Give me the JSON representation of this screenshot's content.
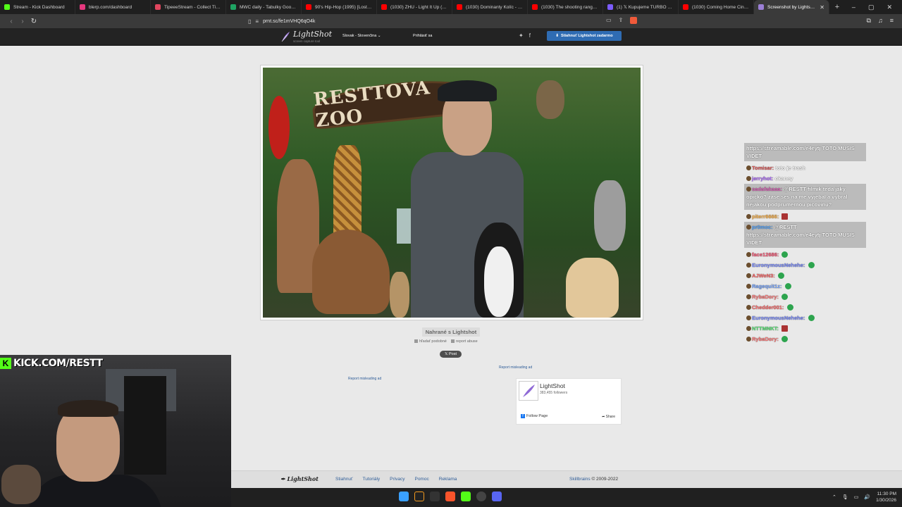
{
  "browser": {
    "tabs": [
      {
        "title": "Stream - Kick Dashboard",
        "color": "#53fc18"
      },
      {
        "title": "blerp.com/dashboard",
        "color": "#e5387e"
      },
      {
        "title": "TipeeeStream - Collect Tips wi",
        "color": "#e0465e"
      },
      {
        "title": "MWC daily - Tabulky Google",
        "color": "#1fa463"
      },
      {
        "title": "90's Hip-Hop (1995) [Lost Der",
        "color": "#ff0000"
      },
      {
        "title": "(1030) ZHU - Light It Up (feat.",
        "color": "#ff0000"
      },
      {
        "title": "(1030) Dominanty Kolíc - ZOO",
        "color": "#ff0000"
      },
      {
        "title": "(1030) The shooting range whe",
        "color": "#ff0000"
      },
      {
        "title": "(1) 𝕏 Kupujeme TURBO na po",
        "color": "#7c5cff"
      },
      {
        "title": "(1030) Coming Home Cinemati",
        "color": "#ff0000"
      },
      {
        "title": "Screenshot by Lightshot",
        "color": "#9b7fd6",
        "active": true
      }
    ],
    "new_tab": "+",
    "url": "prnt.sc/fe1mVHQ6qO4k",
    "window_controls": [
      "–",
      "▢",
      "✕"
    ]
  },
  "lightshot": {
    "logo": "LightShot",
    "logo_sub": "screen capture tool",
    "language": "Slovak - Slovenčina",
    "login": "Prihlásiť sa",
    "download": "Stiahnuť Lightshot zadarmo",
    "screenshot_sign": "RESTTOVA ZOO",
    "uploaded": "Nahrané s Lightshot",
    "find_similar": "hľadať podobné",
    "report_abuse": "report abuse",
    "post": "Post",
    "report_ad_1": "Report misleading ad",
    "report_ad_2": "Report misleading ad",
    "fb": {
      "name": "LightShot",
      "followers": "383,455 followers",
      "follow": "Follow Page",
      "share": "Share"
    },
    "footer": {
      "logo": "LightShot",
      "links": [
        "Stiahnuť",
        "Tutoriály",
        "Privacy",
        "Pomoc",
        "Reklama"
      ],
      "copy_brand": "Skillbrains",
      "copy_years": "© 2009-2022"
    }
  },
  "chat": [
    {
      "user": "",
      "user_color": "#ffffff",
      "message": "https://streamable.com/e4eytj TOTO MUSIS VIDET",
      "highlight": true
    },
    {
      "user": "Tomisar:",
      "user_color": "#e45c5c",
      "message": "toto je trash",
      "highlight": false
    },
    {
      "user": "jerryhot:",
      "user_color": "#b06cff",
      "message": "okaney",
      "highlight": false
    },
    {
      "user": "sadafakaaa:",
      "user_color": "#e06bbd",
      "message": "@RESTT filmik teda jaky opicko? zase ses na me vyjebal a vybral nejakou podprumernou picovinu?",
      "highlight": true
    },
    {
      "user": "piterr6666:",
      "user_color": "#ffb347",
      "message": "",
      "emote": "sq",
      "highlight": false
    },
    {
      "user": "pr0moc:",
      "user_color": "#5aa9ff",
      "message": "@RESTT https://streamable.com/e4eytj TOTO MUSIS VIDET",
      "highlight": true
    },
    {
      "user": "face12686:",
      "user_color": "#ff5c7a",
      "message": "",
      "emote": "g",
      "highlight": false
    },
    {
      "user": "EuronymousNehehe:",
      "user_color": "#7a8cff",
      "message": "",
      "emote": "g",
      "highlight": false
    },
    {
      "user": "AJWeN3:",
      "user_color": "#ff6b6b",
      "message": "",
      "emote": "g",
      "highlight": false
    },
    {
      "user": "Ragequit1z:",
      "user_color": "#7aa8ff",
      "message": "",
      "emote": "g",
      "highlight": false
    },
    {
      "user": "RybaDory:",
      "user_color": "#ff7a7a",
      "message": "",
      "emote": "g",
      "highlight": false
    },
    {
      "user": "Chedder001:",
      "user_color": "#ff6b6b",
      "message": "",
      "emote": "g",
      "highlight": false
    },
    {
      "user": "EuronymousNehehe:",
      "user_color": "#7a8cff",
      "message": "",
      "emote": "g",
      "highlight": false
    },
    {
      "user": "NTTMNKT:",
      "user_color": "#5de67a",
      "message": "",
      "emote": "sq",
      "highlight": false
    },
    {
      "user": "RybaDory:",
      "user_color": "#ff7a7a",
      "message": "",
      "emote": "g",
      "highlight": false
    }
  ],
  "webcam": {
    "label": "KICK.COM/RESTT",
    "k": "K"
  },
  "taskbar": {
    "time": "11:30 PM",
    "date": "1/30/2026"
  }
}
